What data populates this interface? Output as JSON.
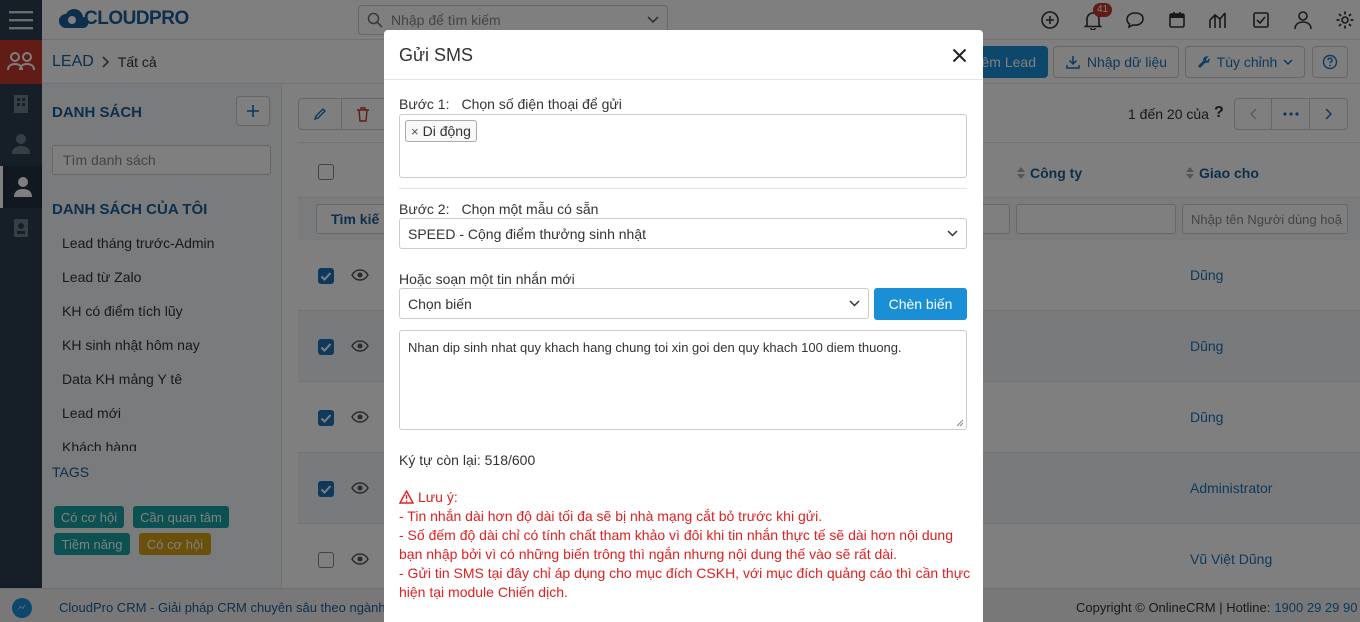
{
  "header": {
    "logo_text": "CLOUDPRO",
    "search_placeholder": "Nhập để tìm kiếm",
    "notification_count": "41"
  },
  "breadcrumb": {
    "module": "LEAD",
    "current": "Tất cả"
  },
  "toolbar": {
    "add_lead_label": "êm Lead",
    "import_label": "Nhập dữ liệu",
    "customize_label": "Tùy chỉnh",
    "pagination_text": "1 đến 20 của",
    "pagination_help": "?"
  },
  "sidebar": {
    "list_title": "DANH SÁCH",
    "search_placeholder": "Tìm danh sách",
    "my_lists_title": "DANH SÁCH CỦA TÔI",
    "items": [
      "Lead tháng trước-Admin",
      "Lead từ Zalo",
      "KH có điểm tích lũy",
      "KH sinh nhật hôm nay",
      "Data KH mảng Y tê",
      "Lead mới",
      "Khách hàng"
    ],
    "tags_title": "TAGS",
    "tags": [
      {
        "label": "Có cơ hội",
        "color": "#17a2a2"
      },
      {
        "label": "Cần quan tâm",
        "color": "#17a2a2"
      },
      {
        "label": "Tiềm năng",
        "color": "#17a2a2"
      },
      {
        "label": "Có cơ hội",
        "color": "#d4a017"
      }
    ]
  },
  "table": {
    "col_company": "Công ty",
    "col_assigned": "Giao cho",
    "search_btn": "Tìm kiế",
    "assigned_placeholder": "Nhập tên Người dùng hoặ",
    "rows": [
      {
        "assigned": "Dũng",
        "checked": true
      },
      {
        "assigned": "Dũng",
        "checked": true
      },
      {
        "assigned": "Dũng",
        "checked": true
      },
      {
        "assigned": "Administrator",
        "checked": true
      },
      {
        "assigned": "Vũ Việt Dũng",
        "checked": false
      }
    ]
  },
  "footer": {
    "left_text": "CloudPro CRM - Giải pháp CRM chuyên sâu theo ngành.",
    "copyright": "Copyright © OnlineCRM | Hotline:",
    "hotline": "1900 29 29 90"
  },
  "modal": {
    "title": "Gửi SMS",
    "step1_label": "Bước 1:",
    "step1_text": "Chọn số điện thoại để gửi",
    "phone_tag": "Di động",
    "step2_label": "Bước 2:",
    "step2_text": "Chọn một mẫu có sẵn",
    "template_value": "SPEED - Cộng điểm thưởng sinh nhật",
    "compose_label": "Hoặc soạn một tin nhắn mới",
    "variable_placeholder": "Chọn biến",
    "insert_btn": "Chèn biến",
    "message": "Nhan dip sinh nhat quy khach hang chung toi xin goi den quy khach 100 diem thuong.",
    "chars_left": "Ký tự còn lại: 518/600",
    "note_title": "Lưu ý:",
    "notes": [
      "- Tin nhắn dài hơn độ dài tối đa sẽ bị nhà mạng cắt bỏ trước khi gửi.",
      "- Số đếm độ dài chỉ có tính chất tham khảo vì đôi khi tin nhắn thực tế sẽ dài hơn nội dung",
      "bạn nhập bởi vì có những biến trông thì ngắn nhưng nội dung thế vào sẽ rất dài.",
      "- Gửi tin SMS tại đây chỉ áp dụng cho mục đích CSKH, với mục đích quảng cáo thì cần thực",
      "hiện tại module Chiến dịch."
    ]
  },
  "colors": {
    "primary": "#1a8fd6",
    "sidebar_dark": "#2d3e50",
    "leads_active": "#c0392b",
    "warning_red": "#e02020",
    "link_blue": "#1a73b8"
  }
}
